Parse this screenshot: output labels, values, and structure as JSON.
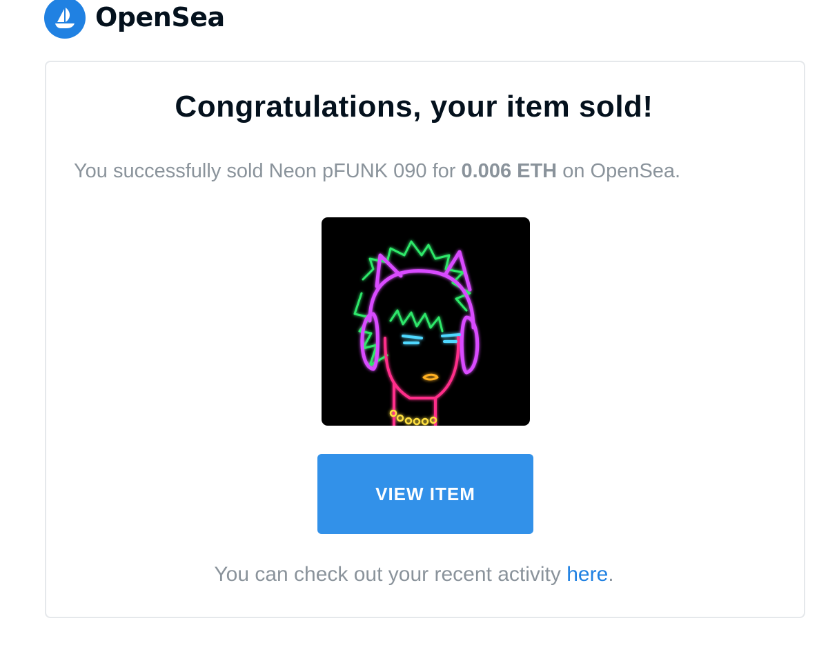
{
  "brand": {
    "name": "OpenSea",
    "logo_icon": "opensea-boat-icon",
    "color": "#2081e2"
  },
  "email": {
    "title": "Congratulations, your item sold!",
    "message_prefix": "You successfully sold Neon pFUNK 090 for ",
    "price": "0.006 ETH",
    "message_suffix": " on OpenSea.",
    "item_image_icon": "neon-punk-artwork",
    "button_label": "VIEW ITEM",
    "button_color": "#3291e9",
    "activity_prefix": "You can check out your recent activity ",
    "activity_link": "here",
    "activity_suffix": "."
  }
}
